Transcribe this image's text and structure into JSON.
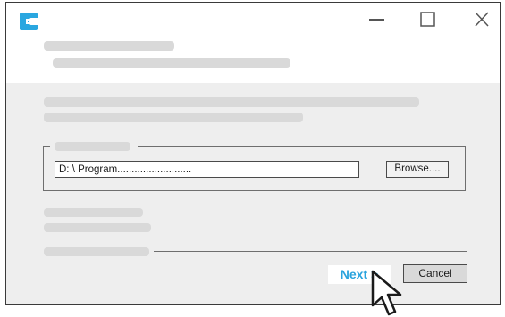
{
  "app": {
    "logo_icon": "app-logo-icon",
    "accent_color": "#29a3dd"
  },
  "window_controls": {
    "minimize_icon": "minimize-icon",
    "maximize_icon": "maximize-icon",
    "close_icon": "close-icon"
  },
  "install_location": {
    "path_value": "D: \\ Program..........................",
    "browse_label": "Browse...."
  },
  "footer": {
    "next_label": "Next >",
    "cancel_label": "Cancel"
  },
  "pointer": {
    "icon": "mouse-pointer-icon"
  }
}
